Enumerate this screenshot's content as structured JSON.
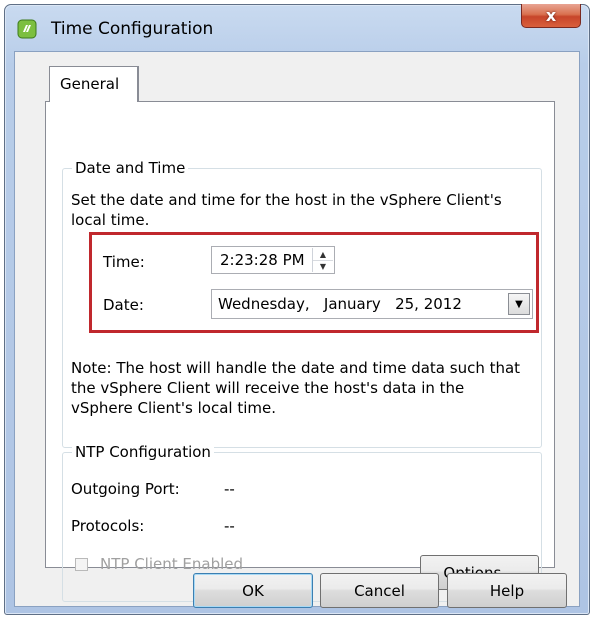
{
  "window": {
    "title": "Time Configuration",
    "close_glyph": "x"
  },
  "tabs": [
    {
      "label": "General",
      "selected": true
    }
  ],
  "date_time": {
    "legend": "Date and Time",
    "description_line1": "Set the date and time for the host in the vSphere Client's",
    "description_line2": "local time.",
    "time_label": "Time:",
    "time_value": "2:23:28 PM",
    "date_label": "Date:",
    "date_value": "Wednesday,   January   25, 2012",
    "note_line1": "Note: The host will handle the date and time data such that",
    "note_line2": "the vSphere Client will receive the host's data in the",
    "note_line3": "vSphere Client's local time."
  },
  "ntp": {
    "legend": "NTP Configuration",
    "outgoing_port_label": "Outgoing Port:",
    "outgoing_port_value": "--",
    "protocols_label": "Protocols:",
    "protocols_value": "--",
    "client_enabled_label": "NTP Client Enabled",
    "client_enabled_checked": false,
    "client_enabled_disabled": true,
    "options_button": "Options..."
  },
  "buttons": {
    "ok": "OK",
    "cancel": "Cancel",
    "help": "Help"
  },
  "colors": {
    "highlight_border": "#c0282d",
    "close_button": "#c7452a",
    "title_bar": "#b8cde9"
  },
  "icons": {
    "app": "vsphere-app-icon",
    "close": "close-icon",
    "spin_up": "spin-up-icon",
    "spin_down": "spin-down-icon",
    "dropdown": "chevron-down-icon"
  }
}
